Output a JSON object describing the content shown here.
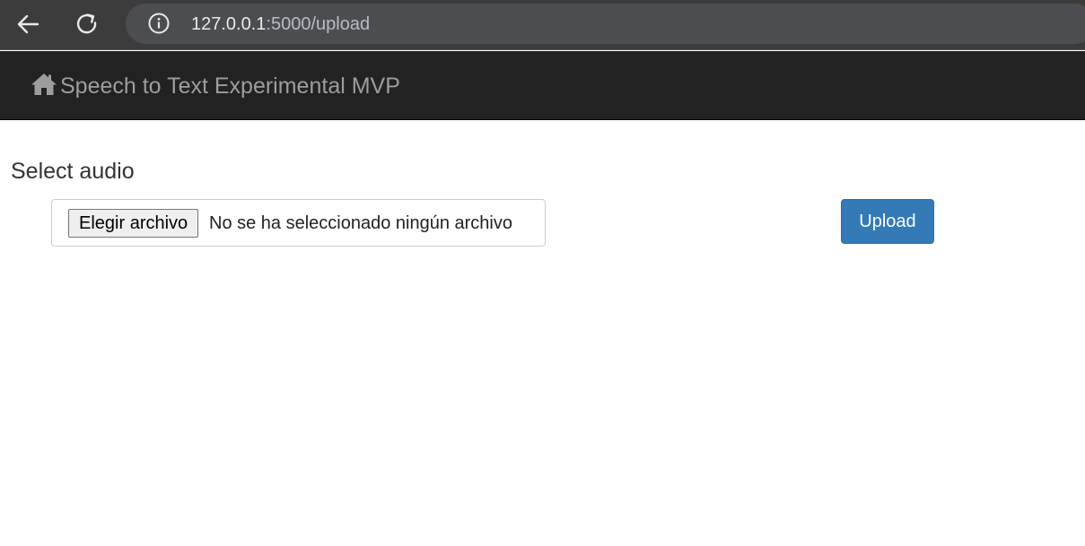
{
  "browser": {
    "url_host": "127.0.0.1",
    "url_path": ":5000/upload",
    "icons": {
      "back": "arrow-left-icon",
      "reload": "reload-icon",
      "info": "info-icon"
    }
  },
  "navbar": {
    "brand_icon": "home-icon",
    "brand_text": "Speech to Text Experimental MVP"
  },
  "main": {
    "heading": "Select audio",
    "file_input": {
      "button_label": "Elegir archivo",
      "status_text": "No se ha seleccionado ningún archivo"
    },
    "upload_button_label": "Upload"
  },
  "colors": {
    "browser_bg": "#3c3c3c",
    "address_bg": "#4c4d50",
    "navbar_bg": "#222222",
    "brand_text": "#9d9d9d",
    "primary_button": "#337ab7"
  }
}
